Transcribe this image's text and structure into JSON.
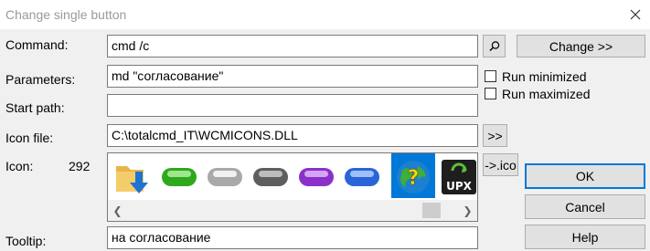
{
  "window": {
    "title": "Change single button"
  },
  "labels": {
    "command": "Command:",
    "parameters": "Parameters:",
    "start_path": "Start path:",
    "icon_file": "Icon file:",
    "icon": "Icon:",
    "icon_number": "292",
    "tooltip": "Tooltip:"
  },
  "fields": {
    "command": "cmd /c",
    "parameters": "md \"согласование\"",
    "start_path": "",
    "icon_file": "C:\\totalcmd_IT\\WCMICONS.DLL",
    "tooltip": "на согласование"
  },
  "checkboxes": {
    "run_minimized": "Run minimized",
    "run_maximized": "Run maximized"
  },
  "buttons": {
    "change": "Change >>",
    "browse_icon": ">>",
    "ico": "->.ico",
    "ok": "OK",
    "cancel": "Cancel",
    "help": "Help"
  },
  "icons": [
    "folder-download-icon",
    "green-pill-icon",
    "light-gray-pill-icon",
    "dark-gray-pill-icon",
    "purple-pill-icon",
    "blue-pill-icon",
    "help-globe-icon",
    "upx-icon"
  ],
  "icons_selected": "help-globe-icon",
  "colors": {
    "selection": "#0078d7",
    "default_button_border": "#0078d7"
  }
}
